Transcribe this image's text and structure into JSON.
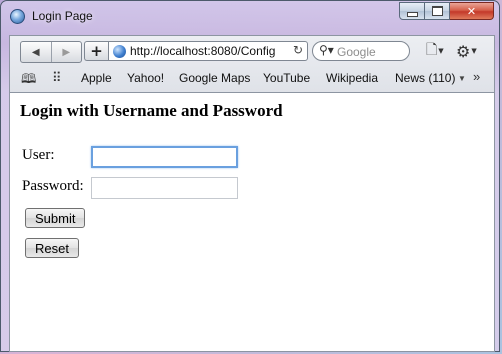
{
  "window": {
    "title": "Login Page",
    "icon": "browser-globe-icon"
  },
  "toolbar": {
    "back_icon": "◀",
    "forward_icon": "▶",
    "add_icon": "+",
    "url": "http://localhost:8080/Config",
    "reload_icon": "↻",
    "search_placeholder": "Google",
    "search_icon": "⚲",
    "page_icon": "🗋",
    "gear_icon": "⚙"
  },
  "bookmarks": {
    "reading_list_icon": "🕮",
    "top_sites_icon": "⠿",
    "items": [
      "Apple",
      "Yahoo!",
      "Google Maps",
      "YouTube",
      "Wikipedia",
      "News (110)"
    ],
    "news_caret": "▼",
    "overflow_icon": "»"
  },
  "page": {
    "heading": "Login with Username and Password",
    "user_label": "User:",
    "user_value": "",
    "password_label": "Password:",
    "password_value": "",
    "submit_label": "Submit",
    "reset_label": "Reset"
  },
  "colors": {
    "focus_ring": "#6aa0df",
    "close_button": "#c4392a"
  }
}
